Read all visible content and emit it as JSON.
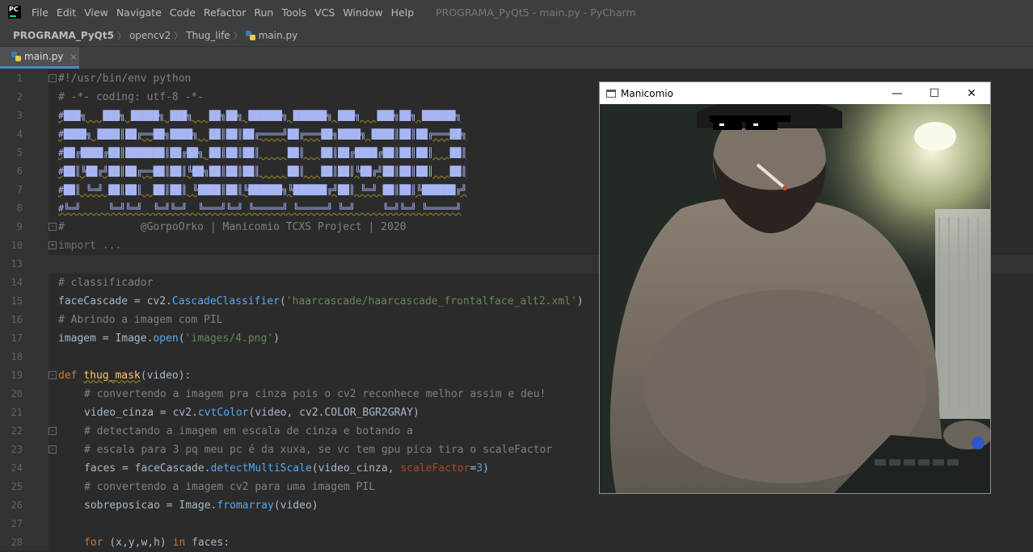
{
  "menubar": {
    "logo_text": "PC",
    "items": [
      "File",
      "Edit",
      "View",
      "Navigate",
      "Code",
      "Refactor",
      "Run",
      "Tools",
      "VCS",
      "Window",
      "Help"
    ],
    "window_title": "PROGRAMA_PyQt5 - main.py - PyCharm"
  },
  "breadcrumb": {
    "project": "PROGRAMA_PyQt5",
    "folder1": "opencv2",
    "folder2": "Thug_life",
    "file": "main.py"
  },
  "tab": {
    "label": "main.py",
    "close": "×"
  },
  "editor": {
    "line_numbers": [
      "1",
      "2",
      "3",
      "4",
      "5",
      "6",
      "7",
      "8",
      "9",
      "10",
      "13",
      "14",
      "15",
      "16",
      "17",
      "18",
      "19",
      "20",
      "21",
      "22",
      "23",
      "24",
      "25",
      "26",
      "27",
      "28"
    ],
    "shebang": "#!/usr/bin/env python",
    "coding": "# -*- coding: utf-8 -*-",
    "banner": [
      "#███╗   ███╗ █████╗ ███╗   ██╗██╗ ██████╗ ██████╗ ███╗   ███╗██╗ ██████╗",
      "#████╗ ████║██╔══██╗████╗  ██║██║██╔════╝██╔═══██╗████╗ ████║██║██╔═══██╗",
      "#██╔████╔██║███████║██╔██╗ ██║██║██║     ██║   ██║██╔████╔██║██║██║   ██║",
      "#██║╚██╔╝██║██╔══██║██║╚██╗██║██║██║     ██║   ██║██║╚██╔╝██║██║██║   ██║",
      "#██║ ╚═╝ ██║██║  ██║██║ ╚████║██║╚██████╗╚██████╔╝██║ ╚═╝ ██║██║╚██████╔╝",
      "#╚═╝     ╚═╝╚═╝  ╚═╝╚═╝  ╚═══╝╚═╝ ╚═════╝ ╚═════╝ ╚═╝     ╚═╝╚═╝ ╚═════╝"
    ],
    "credit": "#            @GorpoOrko | Manicomio TCXS Project | 2020",
    "import_fold": "import ...",
    "c_classificador": "# classificador",
    "facecascade_var": "faceCascade = cv2.",
    "cascade_call": "CascadeClassifier",
    "cascade_str": "'haarcascade/haarcascade_frontalface_alt2.xml'",
    "c_abrindo": "# Abrindo a imagem com PIL",
    "imagem_var": "imagem = Image.",
    "open_call": "open",
    "open_str": "'images/4.png'",
    "def_kw": "def ",
    "def_name": "thug_mask",
    "def_param": "video",
    "c_convertendo1": "# convertendo a imagem pra cinza pois o cv2 reconhece melhor assim e deu!",
    "cinza_var": "video_cinza = cv2.",
    "cvt_call": "cvtColor",
    "cvt_args": "(video, cv2.COLOR_BGR2GRAY)",
    "c_detectando": "# detectando a imagem em escala de cinza e botando a",
    "c_escala": "# escala para 3 pq meu pc é da xuxa, se vc tem gpu pica tira o scaleFactor",
    "faces_var": "faces = faceCascade.",
    "detect_call": "detectMultiScale",
    "detect_args": "(video_cinza, ",
    "scale_kw": "scaleFactor",
    "scale_val": "3",
    "c_convertendo2": "# convertendo a imagem cv2 para uma imagem PIL",
    "sobre_var": "sobreposicao = Image.",
    "fromarray_call": "fromarray",
    "fromarray_args": "(video)",
    "for_kw": "for ",
    "for_vars": "(x,y,w,h) ",
    "in_kw": "in ",
    "for_target": "faces:"
  },
  "cv_window": {
    "title": "Manicomio",
    "min": "—",
    "max": "☐",
    "close": "✕"
  }
}
